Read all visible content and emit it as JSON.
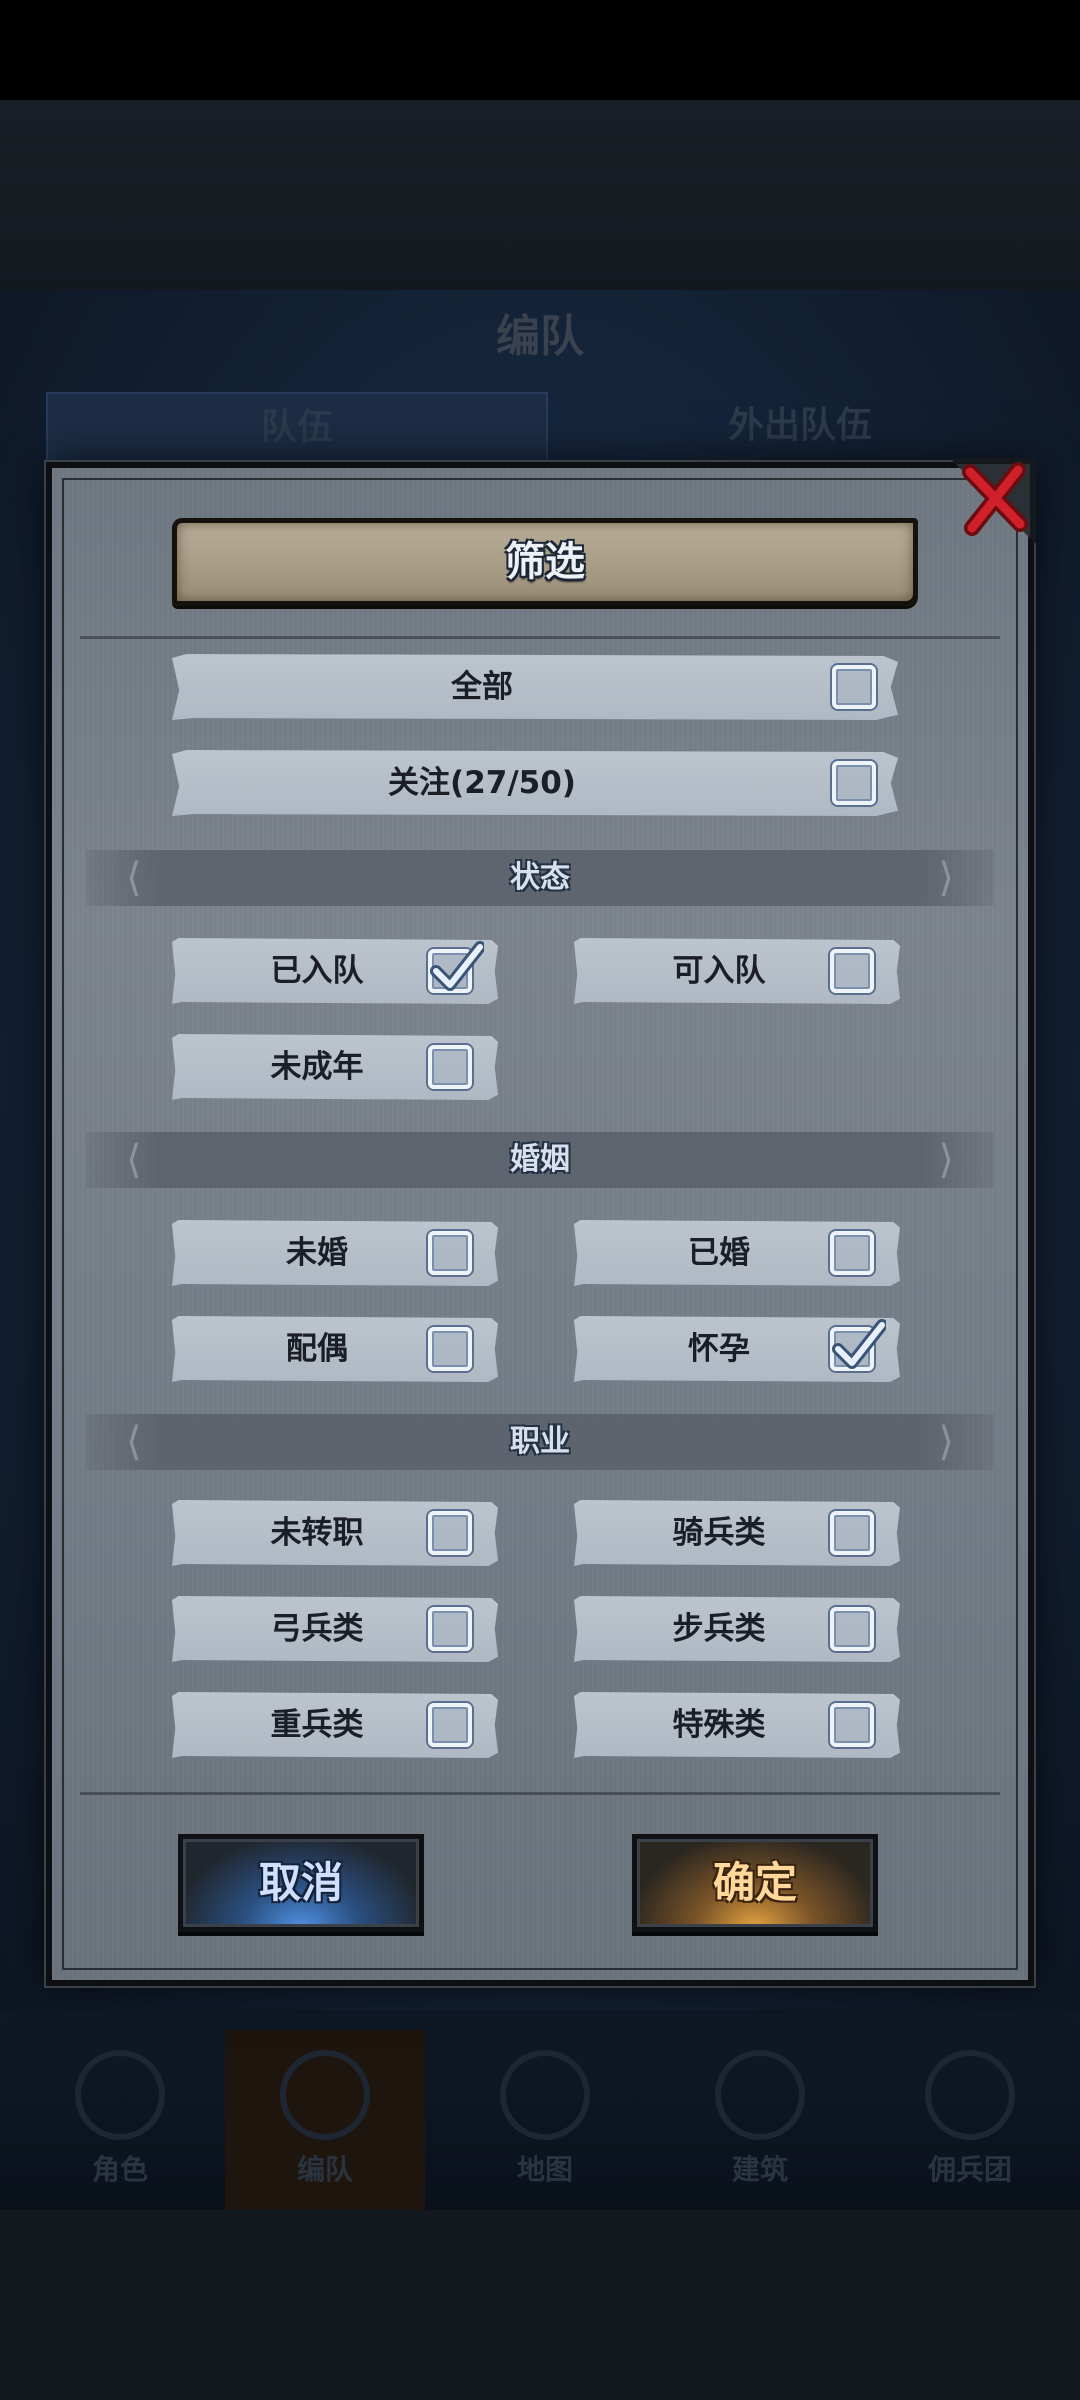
{
  "background": {
    "title": "编队",
    "tabs": [
      "队伍",
      "外出队伍"
    ],
    "nav": [
      "角色",
      "编队",
      "地图",
      "建筑",
      "佣兵团"
    ]
  },
  "dialog": {
    "title": "筛选",
    "close_icon": "close-x-icon",
    "all": {
      "label": "全部",
      "checked": false
    },
    "favorites": {
      "label": "关注(27/50)",
      "checked": false
    },
    "sections": {
      "status": {
        "title": "状态",
        "options": [
          {
            "label": "已入队",
            "checked": true
          },
          {
            "label": "可入队",
            "checked": false
          },
          {
            "label": "未成年",
            "checked": false
          }
        ]
      },
      "marriage": {
        "title": "婚姻",
        "options": [
          {
            "label": "未婚",
            "checked": false
          },
          {
            "label": "已婚",
            "checked": false
          },
          {
            "label": "配偶",
            "checked": false
          },
          {
            "label": "怀孕",
            "checked": true
          }
        ]
      },
      "class": {
        "title": "职业",
        "options": [
          {
            "label": "未转职",
            "checked": false
          },
          {
            "label": "骑兵类",
            "checked": false
          },
          {
            "label": "弓兵类",
            "checked": false
          },
          {
            "label": "步兵类",
            "checked": false
          },
          {
            "label": "重兵类",
            "checked": false
          },
          {
            "label": "特殊类",
            "checked": false
          }
        ]
      }
    },
    "cancel_label": "取消",
    "confirm_label": "确定"
  },
  "colors": {
    "cancel_glow": "#4f8fe0",
    "confirm_glow": "#e0a040",
    "close_red": "#d0202a"
  }
}
